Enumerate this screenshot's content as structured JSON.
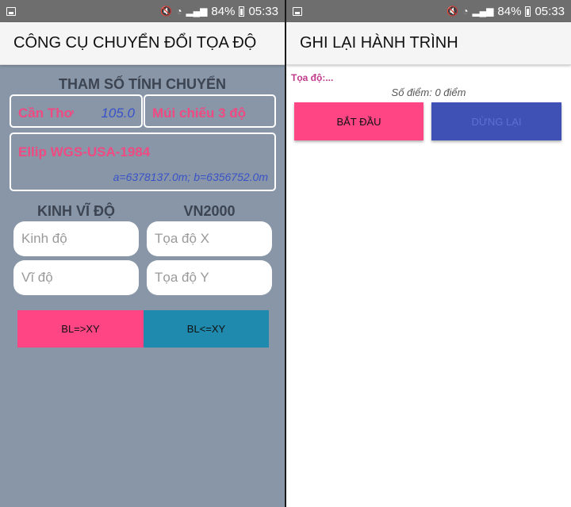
{
  "status": {
    "battery": "84%",
    "time": "05:33"
  },
  "left": {
    "title": "CÔNG CỤ CHUYỂN ĐỔI TỌA ĐỘ",
    "params_title": "THAM SỐ TÍNH CHUYỂN",
    "location_name": "Cần Thơ",
    "location_value": "105.0",
    "zone": "Múi chiếu 3 độ",
    "ellipsoid_name": "Ellip WGS-USA-1984",
    "ellipsoid_params": "a=6378137.0m; b=6356752.0m",
    "latlon_header": "KINH VĨ ĐỘ",
    "vn2000_header": "VN2000",
    "longitude_placeholder": "Kinh độ",
    "latitude_placeholder": "Vĩ độ",
    "x_placeholder": "Tọa độ X",
    "y_placeholder": "Tọa độ Y",
    "btn_bl_to_xy": "BL=>XY",
    "btn_xy_to_bl": "BL<=XY"
  },
  "right": {
    "title": "GHI LẠI HÀNH TRÌNH",
    "coord_label": "Tọa độ:...",
    "point_count": "Số điểm: 0 điểm",
    "start_label": "BẮT ĐẦU",
    "stop_label": "DỪNG LẠI"
  },
  "colors": {
    "left_bg": "#8896a8",
    "pink": "#ff4584",
    "teal": "#1f8aad",
    "indigo": "#3f51b5"
  }
}
